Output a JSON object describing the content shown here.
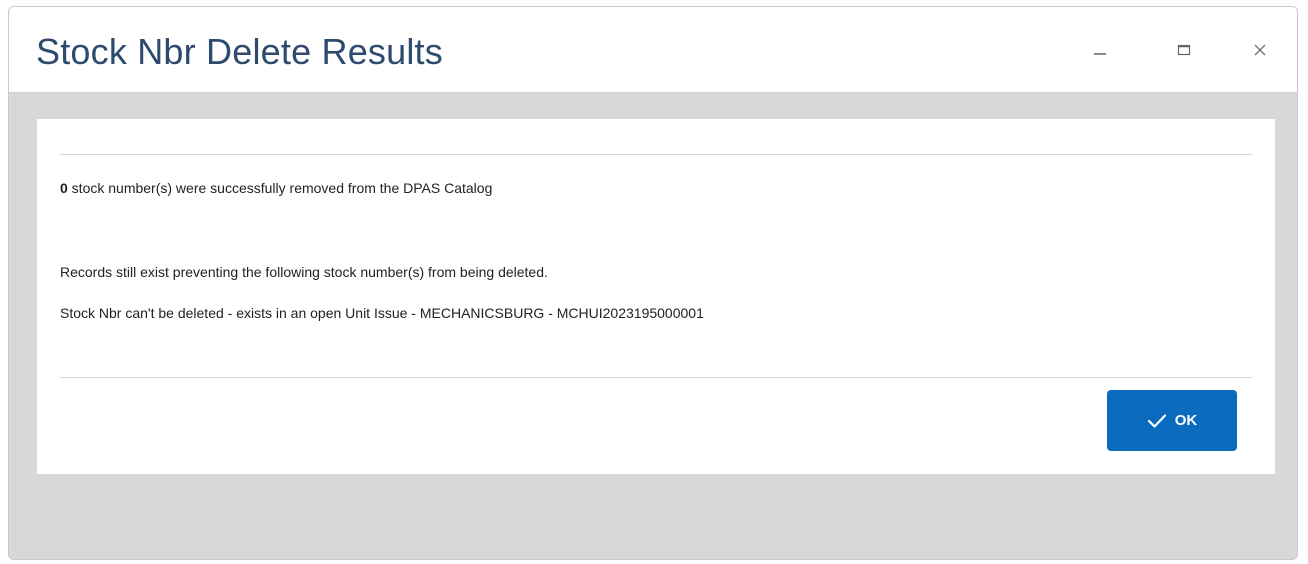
{
  "dialog": {
    "title": "Stock Nbr Delete Results",
    "controls": {
      "minimize_icon": "minimize-icon",
      "maximize_icon": "maximize-icon",
      "close_icon": "close-icon"
    }
  },
  "content": {
    "success_count": "0",
    "success_text": " stock number(s) were successfully removed from the DPAS Catalog",
    "records_text": "Records still exist preventing the following stock number(s) from being deleted.",
    "detail_text": "Stock Nbr can't be deleted - exists in an open Unit Issue - MECHANICSBURG - MCHUI2023195000001"
  },
  "footer": {
    "ok_label": "OK",
    "ok_icon": "checkmark-icon"
  },
  "colors": {
    "title": "#2e4a6e",
    "background": "#d7d8da",
    "primary_button": "#0a6bbf"
  }
}
